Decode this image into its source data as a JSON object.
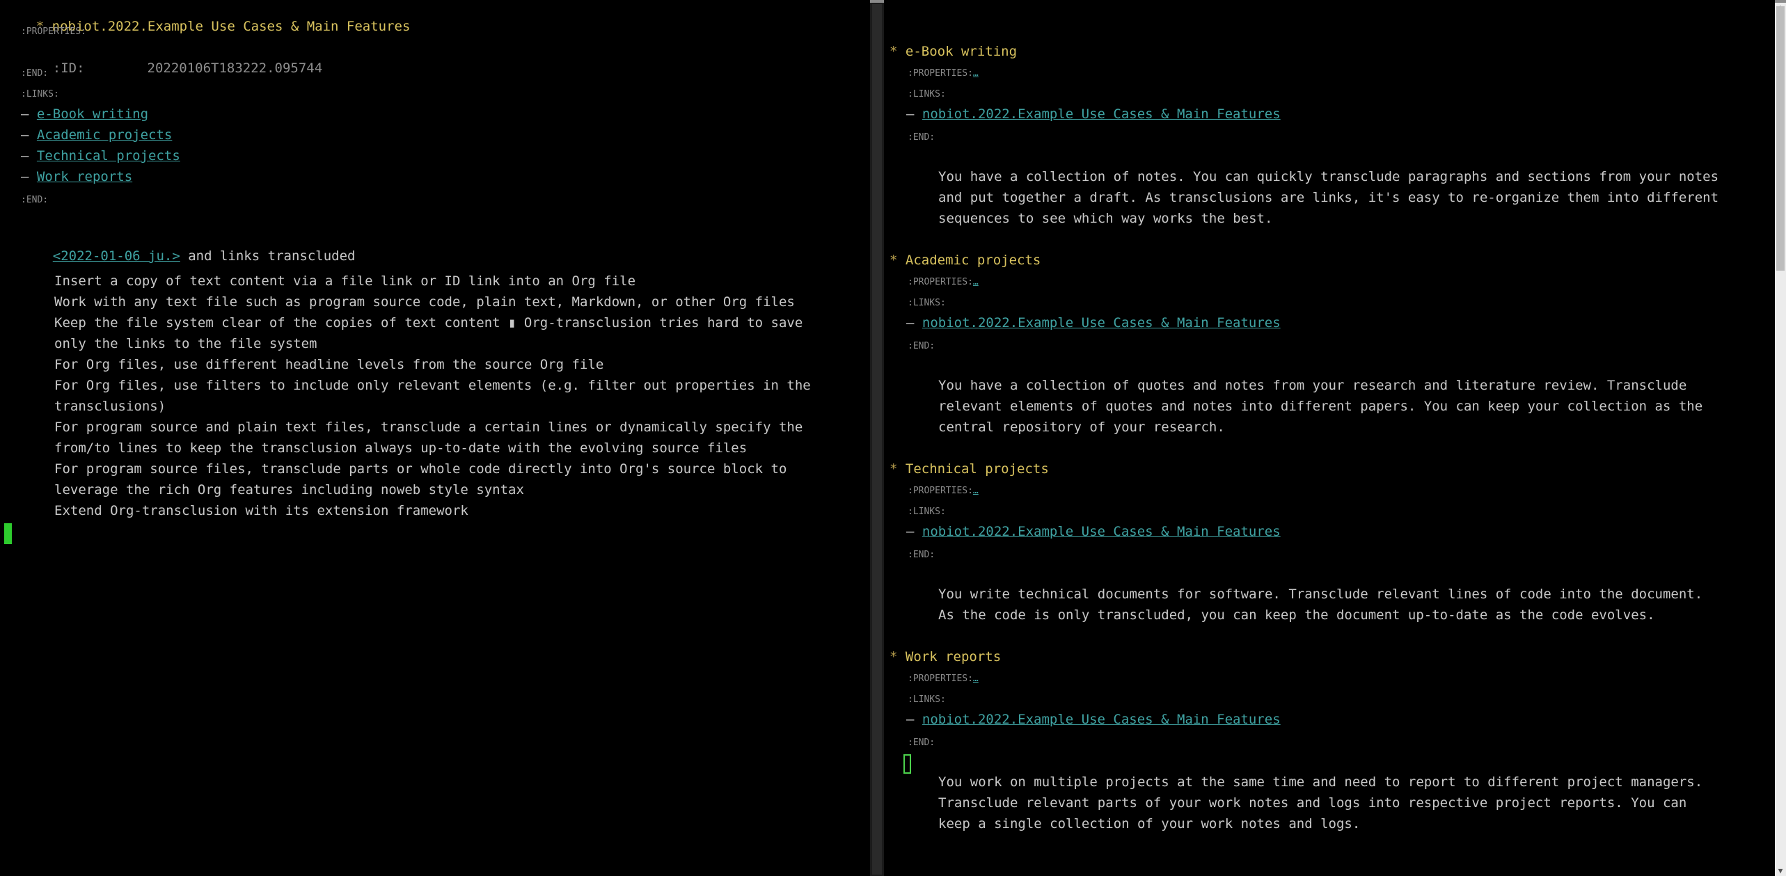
{
  "left": {
    "title": "nobiot.2022.Example Use Cases & Main Features",
    "properties_label": ":PROPERTIES:",
    "id_key": ":ID:",
    "id_value": "20220106T183222.095744",
    "end_label": ":END:",
    "links_label": ":LINKS:",
    "links": [
      "e-Book writing",
      "Academic projects",
      "Technical projects",
      "Work reports"
    ],
    "links_end": ":END:",
    "date_link": "<2022-01-06 ju.>",
    "date_suffix": " and links transcluded",
    "features": [
      "Insert a copy of text content via a file link or ID link into an Org file",
      "Work with any text file such as program source code, plain text, Markdown, or other Org files",
      "Keep the file system clear of the copies of text content ▮ Org-transclusion tries hard to save",
      "only the links to the file system",
      "For Org files, use different headline levels from the source Org file",
      "For Org files, use filters to include only relevant elements (e.g. filter out properties in the",
      "transclusions)",
      "For program source and plain text files, transclude a certain lines or dynamically specify the",
      "from/to lines to keep the transclusion always up-to-date with the evolving source files",
      "For program source files, transclude parts or whole code directly into Org's source block to",
      "leverage the rich Org features including noweb style syntax",
      "Extend Org-transclusion with its extension framework"
    ]
  },
  "right": {
    "properties_label": ":PROPERTIES:",
    "folded_marker": "…",
    "links_label": ":LINKS:",
    "backlink": "nobiot.2022.Example Use Cases & Main Features",
    "end_label": ":END:",
    "sections": [
      {
        "heading": "e-Book writing",
        "body": [
          "You have a collection of notes. You can quickly transclude paragraphs and sections from your notes",
          "and put together a draft. As transclusions are links, it's easy to re-organize them into different",
          "sequences to see which way works the best."
        ]
      },
      {
        "heading": "Academic projects",
        "body": [
          "You have a collection of quotes and notes from your research and literature review. Transclude",
          "relevant elements of quotes and notes into different papers. You can keep your collection as the",
          "central repository of your research."
        ]
      },
      {
        "heading": "Technical projects",
        "body": [
          "You write technical documents for software. Transclude relevant lines of code into the document.",
          "As the code is only transcluded, you can keep the document up-to-date as the code evolves."
        ]
      },
      {
        "heading": "Work reports",
        "body": [
          "You work on multiple projects at the same time and need to report to different project managers.",
          "Transclude relevant parts of your work notes and logs into respective project reports. You can",
          "keep a single collection of your work notes and logs."
        ]
      }
    ]
  },
  "colors": {
    "background": "#000000",
    "heading": "#d8c25e",
    "link": "#3fa2a2",
    "text": "#c8c8c8",
    "drawer": "#8c8c8c",
    "cursor": "#2ecc2e"
  }
}
